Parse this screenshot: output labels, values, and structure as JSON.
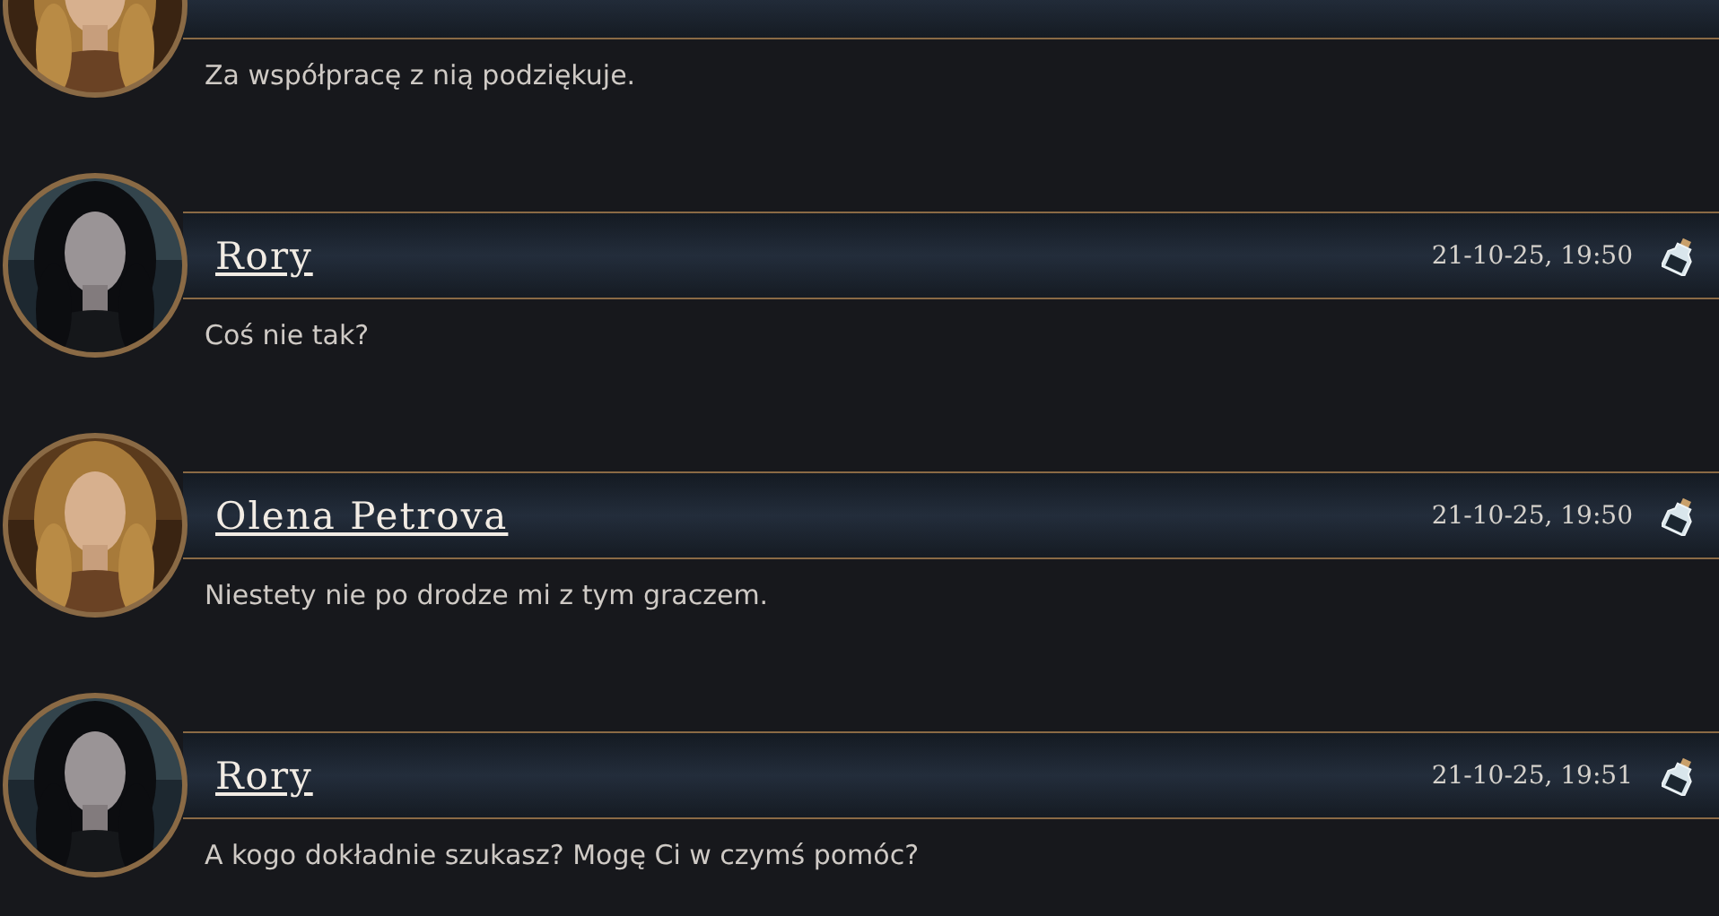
{
  "messages": [
    {
      "text": "Za współpracę z nią podziękuje."
    },
    {
      "author": "Rory",
      "time": "21-10-25, 19:50",
      "text": "Coś nie tak?"
    },
    {
      "author": "Olena Petrova",
      "time": "21-10-25, 19:50",
      "text": "Niestety nie po drodze mi z tym graczem."
    },
    {
      "author": "Rory",
      "time": "21-10-25, 19:51",
      "text": "A kogo dokładnie szukasz? Mogę Ci w czymś pomóc?"
    }
  ]
}
